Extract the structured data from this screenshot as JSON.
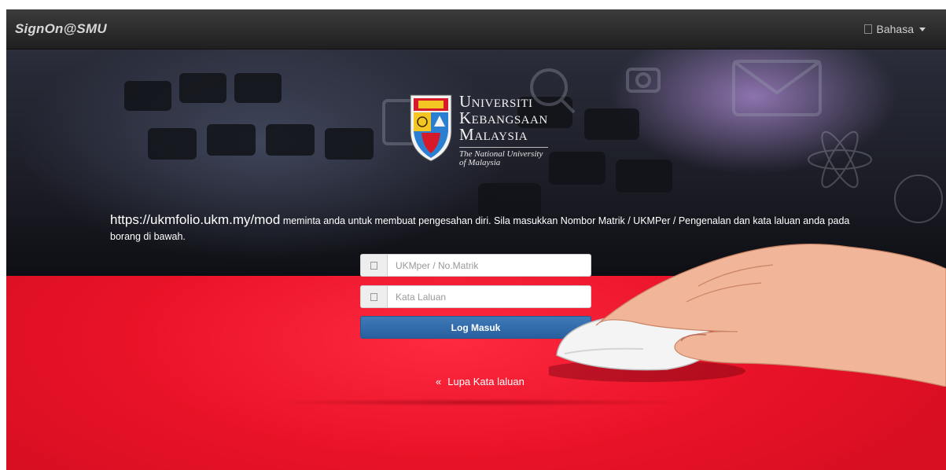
{
  "navbar": {
    "brand": "SignOn@SMU",
    "language_label": "Bahasa",
    "language_icon": "square-glyph-icon"
  },
  "logo": {
    "line1_cap": "U",
    "line1_rest": "NIVERSITI",
    "line2_cap": "K",
    "line2_rest": "EBANGSAAN",
    "line3_cap": "M",
    "line3_rest": "ALAYSIA",
    "subtitle_line1": "The National University",
    "subtitle_line2": "of Malaysia"
  },
  "intro": {
    "url": "https://ukmfolio.ukm.my/mod",
    "message": " meminta anda untuk membuat pengesahan diri. Sila masukkan Nombor Matrik / UKMPer / Pengenalan dan kata laluan anda pada borang di bawah."
  },
  "form": {
    "username_placeholder": "UKMper / No.Matrik",
    "username_value": "",
    "password_placeholder": "Kata Laluan",
    "password_value": "",
    "login_label": "Log Masuk",
    "user_icon": "user-icon",
    "lock_icon": "lock-icon"
  },
  "forgot": {
    "arrow": "«",
    "label": "Lupa Kata laluan"
  },
  "colors": {
    "navbar": "#2b2b2b",
    "red_band": "#e8122a",
    "login_button": "#2f6aa8"
  }
}
